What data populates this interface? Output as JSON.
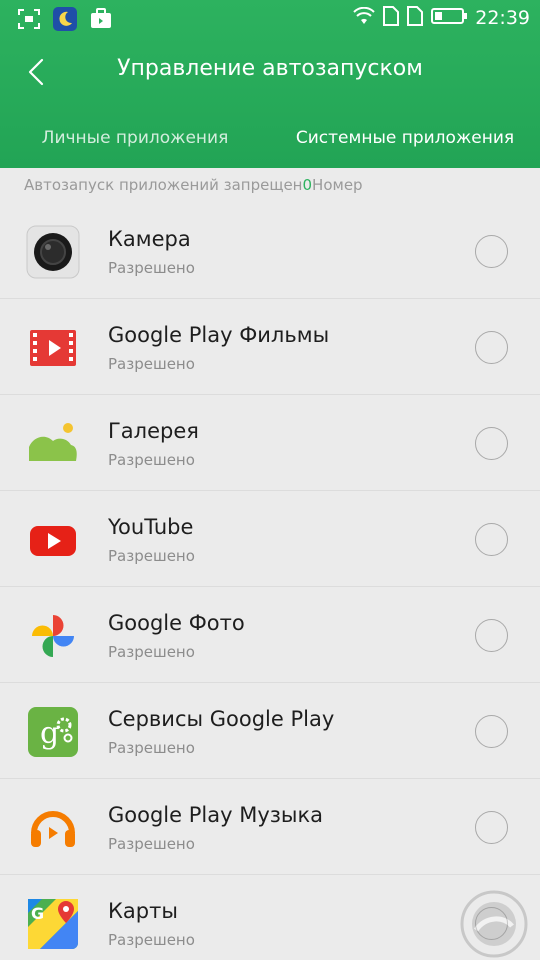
{
  "status_bar": {
    "time": "22:39",
    "left_icons": [
      "screenshot-icon",
      "night-mode-icon",
      "briefcase-icon"
    ],
    "right_icons": [
      "wifi-icon",
      "sim-1-icon",
      "sim-2-icon",
      "battery-icon"
    ]
  },
  "header": {
    "title": "Управление автозапуском",
    "back_icon": "chevron-left-icon",
    "tabs": [
      {
        "label": "Личные приложения",
        "active": false
      },
      {
        "label": "Системные приложения",
        "active": true
      }
    ]
  },
  "summary": {
    "prefix": "Автозапуск приложений запрещен",
    "count": "0",
    "suffix": "Номер"
  },
  "apps": [
    {
      "name": "Камера",
      "status": "Разрешено",
      "icon": "camera-icon",
      "checked": false
    },
    {
      "name": "Google Play Фильмы",
      "status": "Разрешено",
      "icon": "play-movies-icon",
      "checked": false
    },
    {
      "name": "Галерея",
      "status": "Разрешено",
      "icon": "gallery-icon",
      "checked": false
    },
    {
      "name": "YouTube",
      "status": "Разрешено",
      "icon": "youtube-icon",
      "checked": false
    },
    {
      "name": "Google Фото",
      "status": "Разрешено",
      "icon": "google-photos-icon",
      "checked": false
    },
    {
      "name": "Сервисы Google Play",
      "status": "Разрешено",
      "icon": "play-services-icon",
      "checked": false
    },
    {
      "name": "Google Play Музыка",
      "status": "Разрешено",
      "icon": "play-music-icon",
      "checked": false
    },
    {
      "name": "Карты",
      "status": "Разрешено",
      "icon": "maps-icon",
      "checked": false
    }
  ],
  "colors": {
    "accent": "#2db25f",
    "background": "#ebebeb",
    "text_primary": "#1e1e1e",
    "text_secondary": "#8c8c8c"
  }
}
